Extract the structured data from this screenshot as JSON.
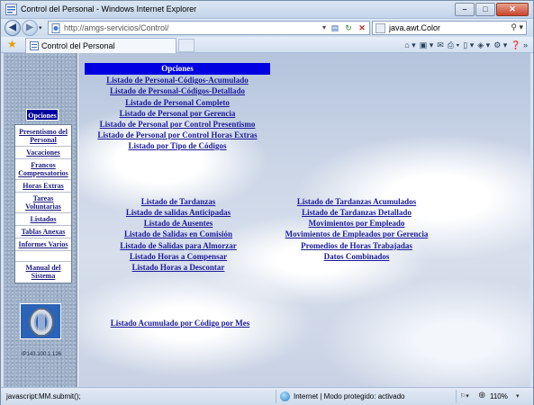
{
  "window": {
    "title": "Control del Personal - Windows Internet Explorer",
    "controls": {
      "minimize": "–",
      "maximize": "□",
      "close": "✕"
    }
  },
  "addressbar": {
    "url": "http://amgs-servicios/Control/",
    "search_text": "java.awt.Color"
  },
  "tabs": [
    {
      "label": "Control del Personal"
    }
  ],
  "leftnav": {
    "opciones_label": "Opciones",
    "menu": [
      {
        "label": "Presentismo del Personal"
      },
      {
        "label": "Vacaciones"
      },
      {
        "label": "Francos Compensatorios"
      },
      {
        "label": "Horas Extras"
      },
      {
        "label": "Tareas Voluntarias"
      },
      {
        "label": "Listados"
      },
      {
        "label": "Tablas Anexas"
      },
      {
        "label": "Informes Varios"
      },
      {
        "label": "Manual del Sistema"
      }
    ],
    "ip_text": "IP143.100.1.126"
  },
  "content": {
    "header": "Opciones",
    "top_links": [
      "Listado de Personal-Códigos-Acumulado",
      "Listado de Personal-Códigos-Detallado",
      "Listado de Personal Completo",
      "Listado de Personal por Gerencia",
      "Listado de Personal por Control Presentismo",
      "Listado de Personal por Control Horas Extras",
      "Listado por Tipo de Códigos"
    ],
    "left_links": [
      "Listado de Tardanzas",
      "Listado de salidas Anticipadas",
      "Listado de Ausentes",
      "Listado de Salidas en Comisión",
      "Listado de Salidas para Almorzar",
      "Listado Horas a Compensar",
      "Listado Horas a Descontar"
    ],
    "right_links": [
      "Listado de Tardanzas Acumulados",
      "Listado de Tardanzas Detallado",
      "Movimientos por Empleado",
      "Movimientos de Empleados por Gerencia",
      "Promedios de Horas Trabajadas",
      "Datos Combinados"
    ],
    "bottom_link": "Listado Acumulado por Código por Mes"
  },
  "statusbar": {
    "status_text": "javascript:MM.submit();",
    "zone_text": "Internet | Modo protegido: activado",
    "zoom": "110%"
  }
}
